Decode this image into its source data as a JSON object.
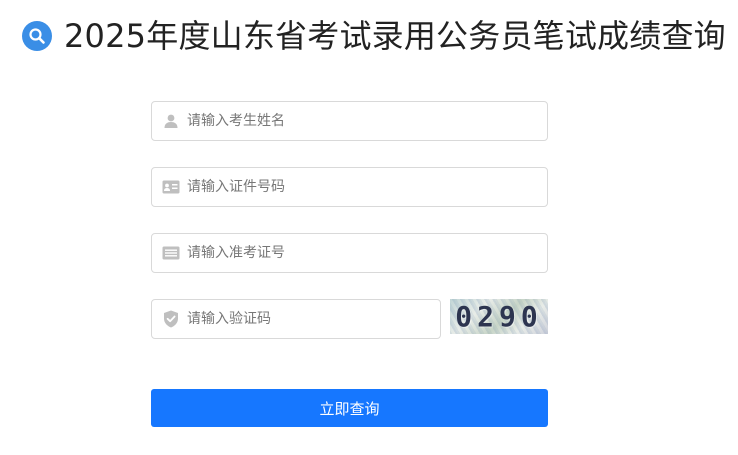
{
  "header": {
    "title": "2025年度山东省考试录用公务员笔试成绩查询",
    "icon": "search-icon",
    "icon_color": "#3a8ee6"
  },
  "form": {
    "name": {
      "placeholder": "请输入考生姓名",
      "icon": "user-icon"
    },
    "id_number": {
      "placeholder": "请输入证件号码",
      "icon": "id-card-icon"
    },
    "ticket_number": {
      "placeholder": "请输入准考证号",
      "icon": "ticket-icon"
    },
    "captcha": {
      "placeholder": "请输入验证码",
      "icon": "shield-check-icon",
      "image_code": "0290"
    },
    "submit_label": "立即查询"
  },
  "colors": {
    "accent": "#1677ff",
    "border": "#d9d9d9",
    "placeholder": "#777777",
    "icon": "#bfbfbf"
  }
}
